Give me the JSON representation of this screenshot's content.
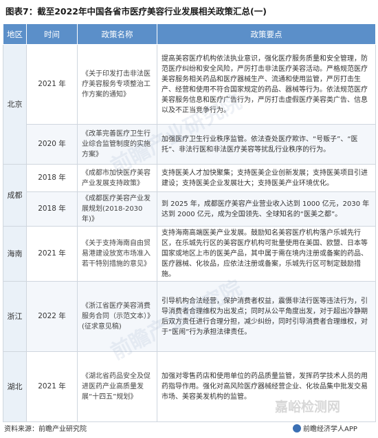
{
  "title": "图表7：截至2022年中国各省市医疗美容行业发展相关政策汇总(一)",
  "headers": [
    "地区",
    "时间",
    "政策名称",
    "政策要点"
  ],
  "rows": [
    {
      "region": "北京",
      "year": "2021 年",
      "policy": "《关于印发打击非法医疗美容服务专项整治工作方案的通知》",
      "points": "提高美容医疗机构依法执业意识，强化医疗服务质量和安全管理，防范医疗纠纷和安全风险，严厉打击非法医疗美容活动。严格规范医疗美容服务相关药品和医疗器械生产、流通和使用监管，严厉打击生产、经营和使用不符合国家规定的药品、器械等行为。依法规范医疗美容服务信息和医疗广告行为，严厉打击虚假医疗美容类广告、信息以及不正当竞争行为。"
    },
    {
      "year": "2020 年",
      "policy": "《改革完善医疗卫生行业综合监管制度的实施方案》",
      "points": "加强医疗卫生行业秩序监管。依法查处医疗欺诈、“号贩子”、“医托”、非法行医和非法医疗美容等扰乱行业秩序的行为。"
    },
    {
      "region": "成都",
      "year": "2018 年",
      "policy": "《成都市加快医疗美容产业发展支持政策》",
      "points": "支持医美人才加快聚集；支持医美企业创新发展；支持医美项目引进建设；支持医美企业发展壮大；支持医美产业环境优化。"
    },
    {
      "year": "2018 年",
      "policy": "《成都医疗美容产业发展规划(2018-2030年)》",
      "points": "到 2025 年，成都医疗美容产业营业收入达到 1000 亿元，2030 年达到 2000 亿元，成为全国领先、全球知名的“医美之都”。"
    },
    {
      "region": "海南",
      "year": "2021 年",
      "policy": "《关于支持海南自由贸易港建设放宽市场准入若干特别措施的意见》",
      "points": "支持海南高端医美产业发展。鼓励知名美容医疗机构落户乐城先行区，在乐城先行区的美容医疗机构可批量使用在美国、欧盟、日本等国家或地区上市的医美产品，其中属于需在境内注册或备案的药品、医疗器械、化妆品，应依法注册或备案，乐城先行区可制定鼓励措施。"
    },
    {
      "region": "浙江",
      "year": "2022 年",
      "policy": "《浙江省医疗美容消费服务合同（示范文本）》(征求意见稿)",
      "points": "引导机构合法经营，保护消费者权益，震慑非法行医等违法行为，引导消费者合理维权为出发点；同时从公平角度出发，对于超出冷静期后双方责任进行合理分担，减少纠纷，同时引导消费者合理维权，对于“医闹”行为承担法律责任。"
    },
    {
      "region": "湖北",
      "year": "2021 年",
      "policy": "《湖北省药品安全及促进医药产业高质量发展“十四五”规划》",
      "points": "加强对零售药店和使用单位的药品质量监管，发挥药学技术人员的用药指导作用。强化对高风险医疗器械经营企业、化妆品集中批发交易市场、美容美发机构的监管。"
    }
  ],
  "footer": {
    "source": "资料来源：前瞻产业研究院",
    "brand": "前瞻经济学人APP"
  },
  "watermarks": {
    "main": "前瞻产业研究院",
    "corner": "嘉峪检测网"
  }
}
